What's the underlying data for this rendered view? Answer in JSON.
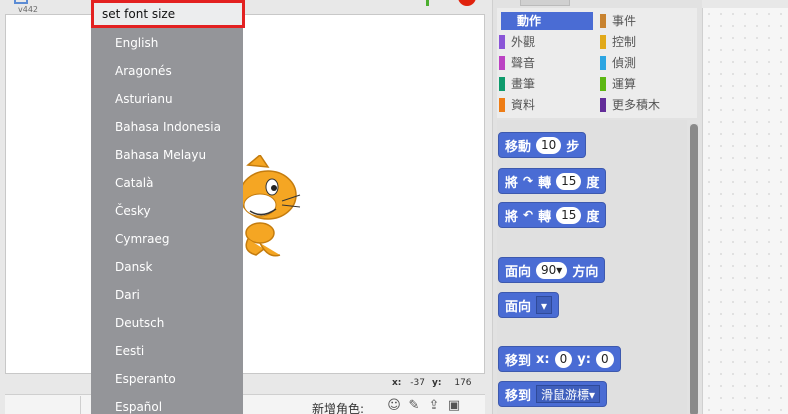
{
  "stage": {
    "version": "v442",
    "coords": {
      "x_label": "x:",
      "x_value": "-37",
      "y_label": "y:",
      "y_value": "176"
    },
    "new_sprite_label": "新增角色:"
  },
  "language_menu": {
    "highlighted_item": "set font size",
    "items": [
      "English",
      "Aragonés",
      "Asturianu",
      "Bahasa Indonesia",
      "Bahasa Melayu",
      "Català",
      "Česky",
      "Cymraeg",
      "Dansk",
      "Dari",
      "Deutsch",
      "Eesti",
      "Esperanto",
      "Español"
    ]
  },
  "categories": [
    {
      "label": "動作",
      "color": "#4a6cd4",
      "active": true
    },
    {
      "label": "外觀",
      "color": "#8a55d7"
    },
    {
      "label": "聲音",
      "color": "#bb42c3"
    },
    {
      "label": "畫筆",
      "color": "#0e9a6c"
    },
    {
      "label": "資料",
      "color": "#ee7d16"
    },
    {
      "label": "事件",
      "color": "#c88330"
    },
    {
      "label": "控制",
      "color": "#e1a91a"
    },
    {
      "label": "偵測",
      "color": "#2ca5e2"
    },
    {
      "label": "運算",
      "color": "#5cb712"
    },
    {
      "label": "更多積木",
      "color": "#632d99"
    }
  ],
  "blocks": {
    "move": {
      "prefix": "移動",
      "value": "10",
      "suffix": "步"
    },
    "turn_right": {
      "prefix": "將",
      "icon": "↷",
      "middle": "轉",
      "value": "15",
      "suffix": "度"
    },
    "turn_left": {
      "prefix": "將",
      "icon": "↶",
      "middle": "轉",
      "value": "15",
      "suffix": "度"
    },
    "point_direction": {
      "prefix": "面向",
      "value": "90▾",
      "suffix": "方向"
    },
    "point_towards": {
      "prefix": "面向",
      "dropdown": "▾"
    },
    "goto_xy": {
      "prefix": "移到",
      "x_label": "x:",
      "x_value": "0",
      "y_label": "y:",
      "y_value": "0"
    },
    "goto": {
      "prefix": "移到",
      "dropdown": "滑鼠游標▾"
    }
  }
}
